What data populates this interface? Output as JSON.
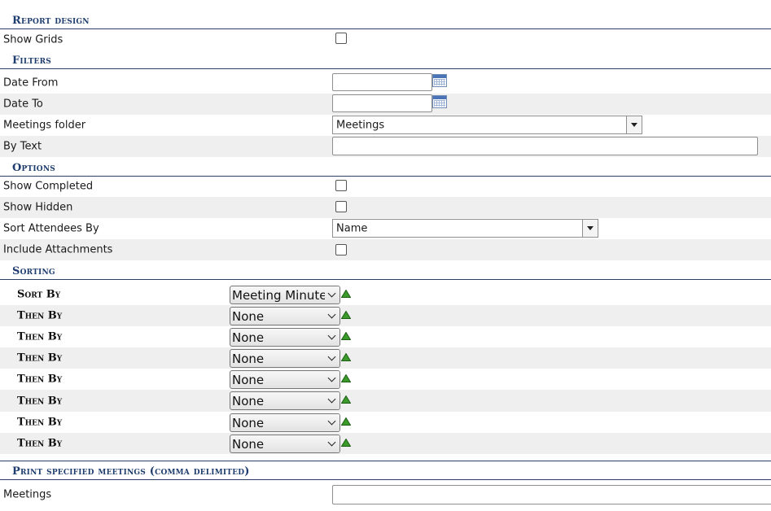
{
  "sections": {
    "report_design": "Report design",
    "filters": "Filters",
    "options": "Options",
    "sorting": "Sorting",
    "print_specified": "Print specified meetings (comma delimited)"
  },
  "report_design": {
    "show_grids_label": "Show Grids",
    "show_grids_checked": false
  },
  "filters": {
    "date_from_label": "Date From",
    "date_from_value": "",
    "date_to_label": "Date To",
    "date_to_value": "",
    "meetings_folder_label": "Meetings folder",
    "meetings_folder_value": "Meetings",
    "by_text_label": "By Text",
    "by_text_value": ""
  },
  "options": {
    "show_completed_label": "Show Completed",
    "show_hidden_label": "Show Hidden",
    "sort_attendees_label": "Sort Attendees By",
    "sort_attendees_value": "Name",
    "include_attachments_label": "Include Attachments"
  },
  "sorting": {
    "rows": [
      {
        "label": "Sort By",
        "value": "Meeting Minute"
      },
      {
        "label": "Then By",
        "value": "None"
      },
      {
        "label": "Then By",
        "value": "None"
      },
      {
        "label": "Then By",
        "value": "None"
      },
      {
        "label": "Then By",
        "value": "None"
      },
      {
        "label": "Then By",
        "value": "None"
      },
      {
        "label": "Then By",
        "value": "None"
      },
      {
        "label": "Then By",
        "value": "None"
      }
    ],
    "direction_icon": "ascending-triangle-icon"
  },
  "print_specified": {
    "meetings_label": "Meetings",
    "meetings_value": ""
  },
  "colors": {
    "section_title": "#1f3d6e",
    "section_rule": "#2b3f63",
    "alt_row": "#efefef",
    "sort_arrow": "#3a9a2a"
  }
}
